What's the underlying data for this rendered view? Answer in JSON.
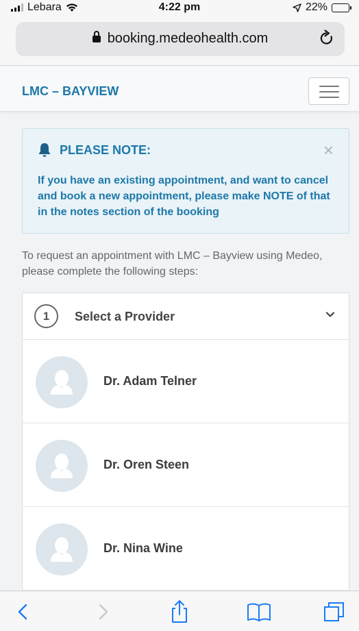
{
  "status_bar": {
    "carrier": "Lebara",
    "time": "4:22 pm",
    "battery_percent": "22%",
    "battery_level": 0.22
  },
  "browser": {
    "url": "booking.medeohealth.com"
  },
  "site": {
    "brand": "LMC – BAYVIEW",
    "accent_color": "#1d78a8"
  },
  "notice": {
    "title": "PLEASE NOTE:",
    "close_symbol": "×",
    "body": "If you have an existing appointment, and want to cancel and book a new appointment, please make NOTE of that in the notes section of the booking"
  },
  "intro": "To request an appointment with LMC – Bayview using Medeo, please complete the following steps:",
  "step": {
    "number": "1",
    "title": "Select a Provider"
  },
  "providers": [
    {
      "name": "Dr. Adam Telner"
    },
    {
      "name": "Dr. Oren Steen"
    },
    {
      "name": "Dr. Nina Wine"
    }
  ],
  "icons": {
    "wifi": "wifi-icon",
    "location": "location-arrow-icon",
    "lock": "lock-icon",
    "reload": "reload-icon",
    "bell": "bell-icon",
    "avatar": "user-silhouette-icon",
    "back": "chevron-left-icon",
    "forward": "chevron-right-icon",
    "share": "share-icon",
    "bookmarks": "book-icon",
    "tabs": "tabs-icon"
  }
}
